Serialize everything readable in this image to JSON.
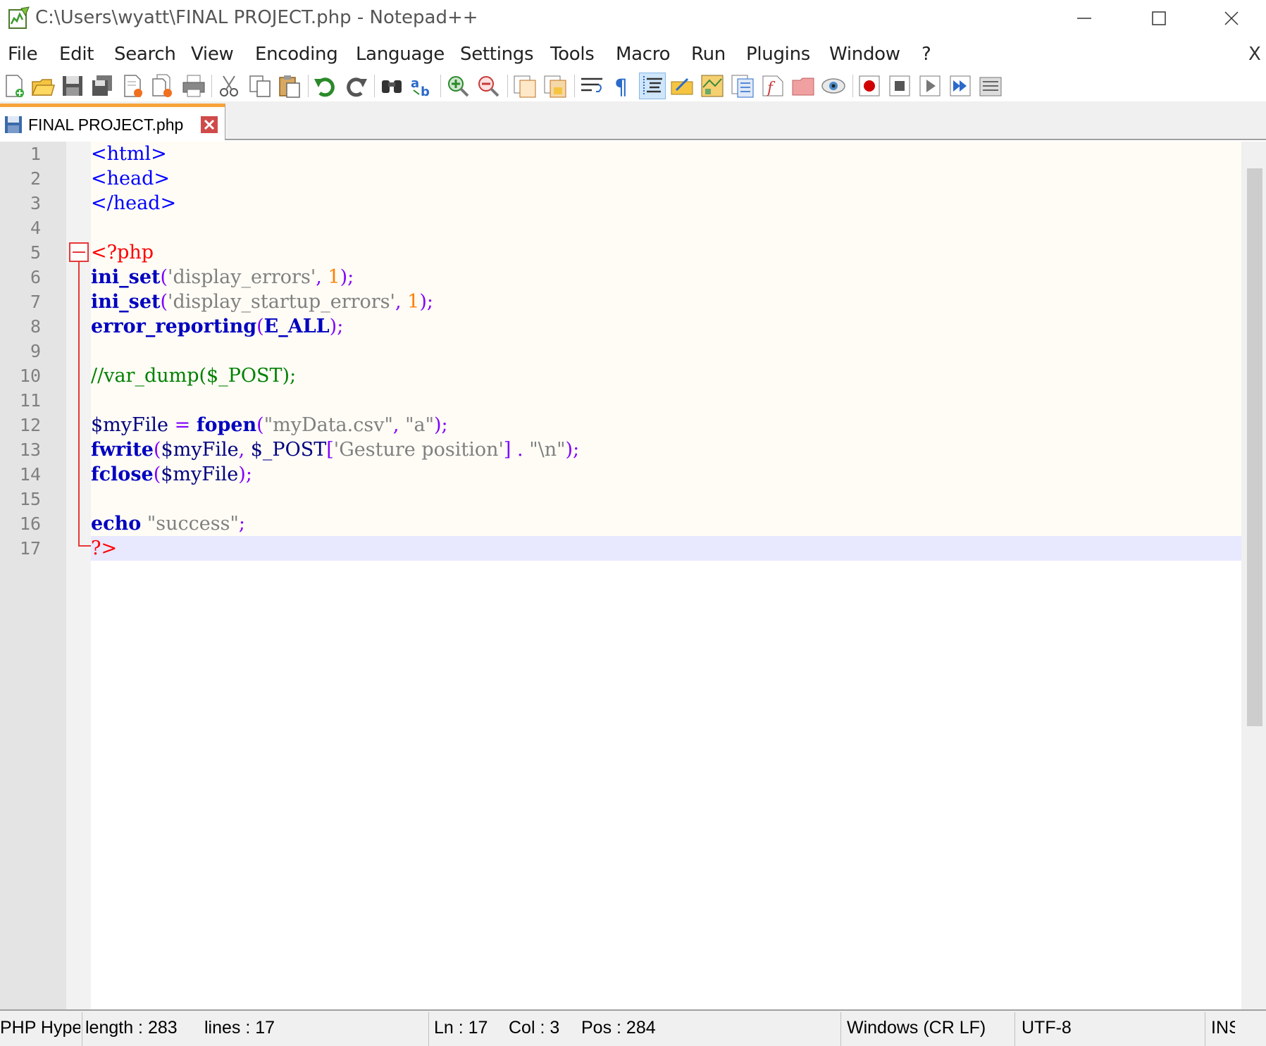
{
  "window": {
    "title": "C:\\Users\\wyatt\\FINAL PROJECT.php - Notepad++"
  },
  "menu": {
    "items": [
      "File",
      "Edit",
      "Search",
      "View",
      "Encoding",
      "Language",
      "Settings",
      "Tools",
      "Macro",
      "Run",
      "Plugins",
      "Window",
      "?"
    ],
    "close_doc": "X"
  },
  "toolbar": {
    "icons": [
      "new-file-icon",
      "open-file-icon",
      "save-icon",
      "save-all-icon",
      "close-icon",
      "close-all-icon",
      "print-icon",
      "cut-icon",
      "copy-icon",
      "paste-icon",
      "undo-icon",
      "redo-icon",
      "find-icon",
      "replace-icon",
      "zoom-in-icon",
      "zoom-out-icon",
      "sync-vertical-icon",
      "sync-horizontal-icon",
      "word-wrap-icon",
      "show-all-characters-icon",
      "indent-guide-icon",
      "user-language-icon",
      "document-map-icon",
      "function-list-icon",
      "folder-as-workspace-icon",
      "monitoring-icon",
      "record-macro-icon",
      "stop-recording-icon",
      "play-macro-icon",
      "run-macro-multiple-icon",
      "save-macro-icon"
    ]
  },
  "tab": {
    "label": "FINAL PROJECT.php"
  },
  "editor": {
    "line_numbers": [
      "1",
      "2",
      "3",
      "4",
      "5",
      "6",
      "7",
      "8",
      "9",
      "10",
      "11",
      "12",
      "13",
      "14",
      "15",
      "16",
      "17"
    ],
    "lines": [
      [
        {
          "t": "<html>",
          "c": "t-tag"
        }
      ],
      [
        {
          "t": "<head>",
          "c": "t-tag"
        }
      ],
      [
        {
          "t": "</head>",
          "c": "t-tag"
        }
      ],
      [],
      [
        {
          "t": "<?php",
          "c": "t-php"
        }
      ],
      [
        {
          "t": "ini_set",
          "c": "t-fn"
        },
        {
          "t": "(",
          "c": "t-op"
        },
        {
          "t": "'display_errors'",
          "c": "t-str"
        },
        {
          "t": ", ",
          "c": "t-op"
        },
        {
          "t": "1",
          "c": "t-num"
        },
        {
          "t": ");",
          "c": "t-op"
        }
      ],
      [
        {
          "t": "ini_set",
          "c": "t-fn"
        },
        {
          "t": "(",
          "c": "t-op"
        },
        {
          "t": "'display_startup_errors'",
          "c": "t-str"
        },
        {
          "t": ", ",
          "c": "t-op"
        },
        {
          "t": "1",
          "c": "t-num"
        },
        {
          "t": ");",
          "c": "t-op"
        }
      ],
      [
        {
          "t": "error_reporting",
          "c": "t-fn"
        },
        {
          "t": "(",
          "c": "t-op"
        },
        {
          "t": "E_ALL",
          "c": "t-key"
        },
        {
          "t": ");",
          "c": "t-op"
        }
      ],
      [],
      [
        {
          "t": "//var_dump($_POST);",
          "c": "t-cmt"
        }
      ],
      [],
      [
        {
          "t": "$myFile",
          "c": "t-var"
        },
        {
          "t": " = ",
          "c": "t-op"
        },
        {
          "t": "fopen",
          "c": "t-fn"
        },
        {
          "t": "(",
          "c": "t-op"
        },
        {
          "t": "\"myData.csv\"",
          "c": "t-str"
        },
        {
          "t": ", ",
          "c": "t-op"
        },
        {
          "t": "\"a\"",
          "c": "t-str"
        },
        {
          "t": ");",
          "c": "t-op"
        }
      ],
      [
        {
          "t": "fwrite",
          "c": "t-fn"
        },
        {
          "t": "(",
          "c": "t-op"
        },
        {
          "t": "$myFile",
          "c": "t-var"
        },
        {
          "t": ", ",
          "c": "t-op"
        },
        {
          "t": "$_POST",
          "c": "t-var"
        },
        {
          "t": "[",
          "c": "t-op"
        },
        {
          "t": "'Gesture position'",
          "c": "t-str"
        },
        {
          "t": "] . ",
          "c": "t-op"
        },
        {
          "t": "\"\\n\"",
          "c": "t-str"
        },
        {
          "t": ");",
          "c": "t-op"
        }
      ],
      [
        {
          "t": "fclose",
          "c": "t-fn"
        },
        {
          "t": "(",
          "c": "t-op"
        },
        {
          "t": "$myFile",
          "c": "t-var"
        },
        {
          "t": ");",
          "c": "t-op"
        }
      ],
      [],
      [
        {
          "t": "echo",
          "c": "t-key"
        },
        {
          "t": " ",
          "c": "t-op"
        },
        {
          "t": "\"success\"",
          "c": "t-str"
        },
        {
          "t": ";",
          "c": "t-op"
        }
      ],
      [
        {
          "t": "?>",
          "c": "t-php"
        }
      ]
    ]
  },
  "status": {
    "language": "PHP Hype",
    "length": "length : 283",
    "lines": "lines : 17",
    "ln": "Ln : 17",
    "col": "Col : 3",
    "pos": "Pos : 284",
    "eol": "Windows (CR LF)",
    "encoding": "UTF-8",
    "mode": "INS"
  }
}
